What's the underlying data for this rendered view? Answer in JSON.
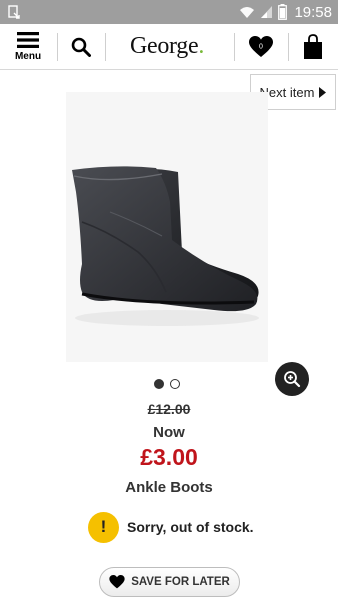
{
  "status_bar": {
    "time": "19:58",
    "icons": [
      "notification-icon",
      "wifi-icon",
      "signal-icon",
      "battery-icon"
    ]
  },
  "header": {
    "menu_label": "Menu",
    "brand": "George",
    "brand_dot": ".",
    "icons": [
      "menu-icon",
      "search-icon",
      "heart-icon",
      "shopping-bag-icon"
    ]
  },
  "nav": {
    "next_item_label": "Next item"
  },
  "gallery": {
    "image_count": 2,
    "active_index": 0
  },
  "product": {
    "was_price": "£12.00",
    "now_label": "Now",
    "now_price": "£3.00",
    "title": "Ankle Boots"
  },
  "stock": {
    "icon_text": "!",
    "message": "Sorry, out of stock."
  },
  "actions": {
    "save_label": "SAVE FOR LATER"
  },
  "colors": {
    "price_red": "#c0141b",
    "warning_yellow": "#f5c000",
    "brand_dot_green": "#79b93a",
    "status_bar": "#9e9e9e"
  }
}
